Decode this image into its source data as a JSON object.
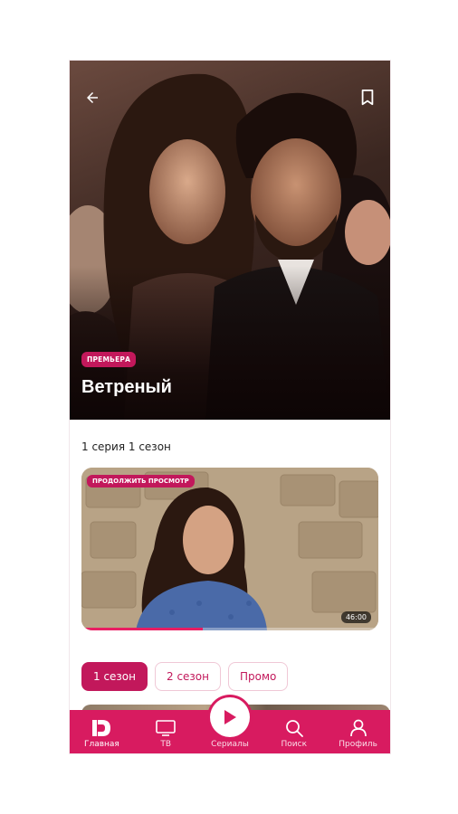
{
  "hero": {
    "badge": "ПРЕМЬЕРА",
    "title": "Ветреный"
  },
  "episode": {
    "label": "1 серия 1 сезон",
    "continue_badge": "ПРОДОЛЖИТЬ ПРОСМОТР",
    "duration": "46:00",
    "progress": 0.41
  },
  "seasons": [
    {
      "label": "1 сезон",
      "active": true
    },
    {
      "label": "2 сезон",
      "active": false
    },
    {
      "label": "Промо",
      "active": false
    }
  ],
  "nav": {
    "home": "Главная",
    "tv": "ТВ",
    "series": "Сериалы",
    "search": "Поиск",
    "profile": "Профиль"
  },
  "colors": {
    "accent": "#c2185b",
    "nav_bg": "#d81b60"
  },
  "icons": [
    "back-arrow-icon",
    "bookmark-icon",
    "play-icon",
    "home-logo-icon",
    "tv-icon",
    "search-icon",
    "profile-icon"
  ]
}
